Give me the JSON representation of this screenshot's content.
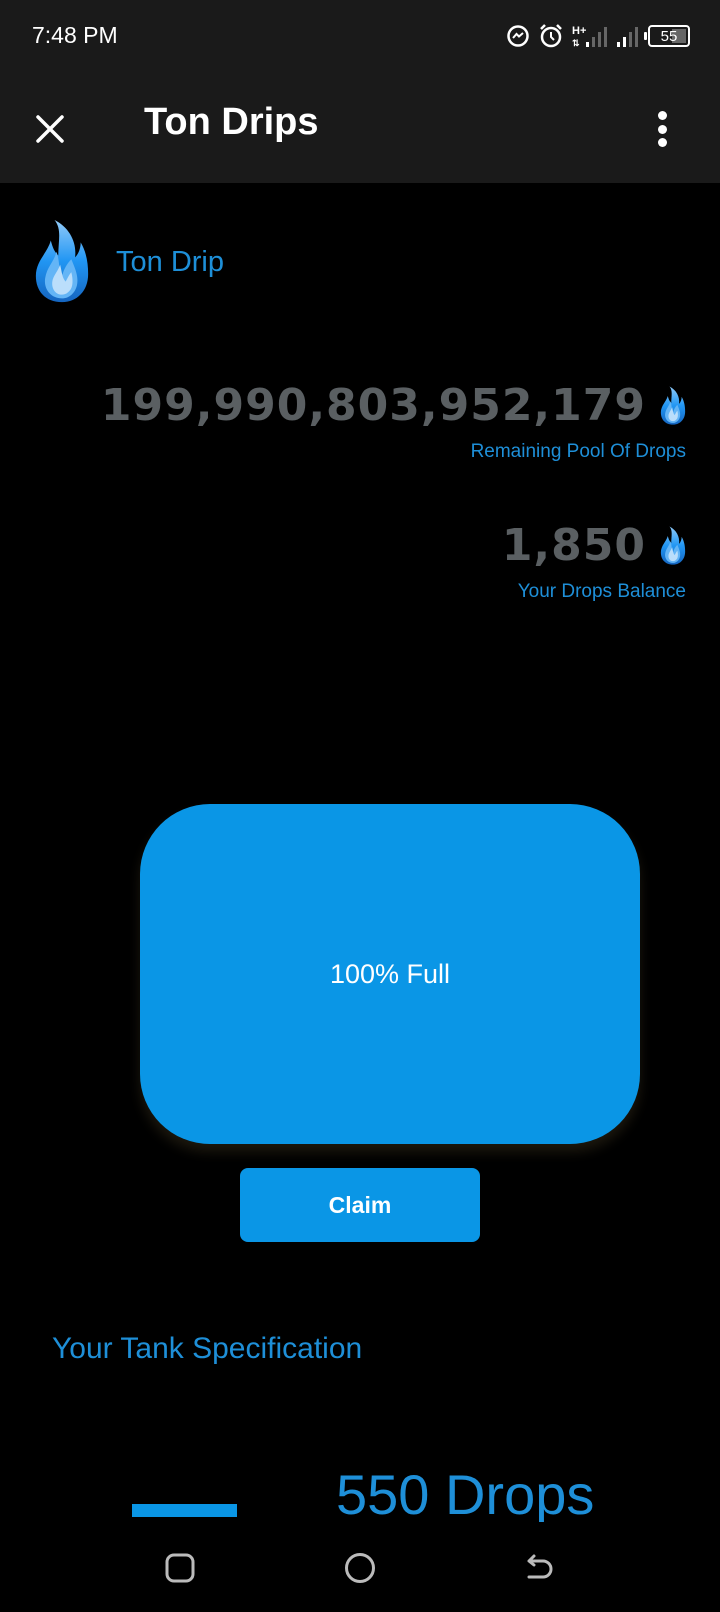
{
  "status_bar": {
    "time": "7:48 PM",
    "network_type": "H+",
    "battery_level": "55",
    "icons": [
      "messenger-icon",
      "alarm-icon",
      "mobile-data-icon",
      "signal-icon",
      "battery-icon"
    ]
  },
  "app_bar": {
    "title": "Ton Drips",
    "close_icon": "close-icon",
    "menu_icon": "more-vert-icon"
  },
  "brand": {
    "name": "Ton Drip",
    "logo_icon": "flame-drop-icon"
  },
  "stats": {
    "pool": {
      "value": "199,990,803,952,179",
      "label": "Remaining Pool Of Drops",
      "icon": "flame-drop-icon"
    },
    "balance": {
      "value": "1,850",
      "label": "Your Drops Balance",
      "icon": "flame-drop-icon"
    }
  },
  "tank": {
    "label": "100% Full",
    "fill_percent": 100
  },
  "actions": {
    "claim_label": "Claim"
  },
  "spec": {
    "title": "Your Tank Specification",
    "value": "550 Drops"
  },
  "nav_bar": {
    "buttons": [
      "recents",
      "home",
      "back"
    ]
  },
  "colors": {
    "accent": "#0a96e6",
    "accent_text": "#1e8fd8",
    "stat_value": "#5a5f62",
    "app_bar_bg": "#1a1a1a",
    "background": "#000000"
  }
}
